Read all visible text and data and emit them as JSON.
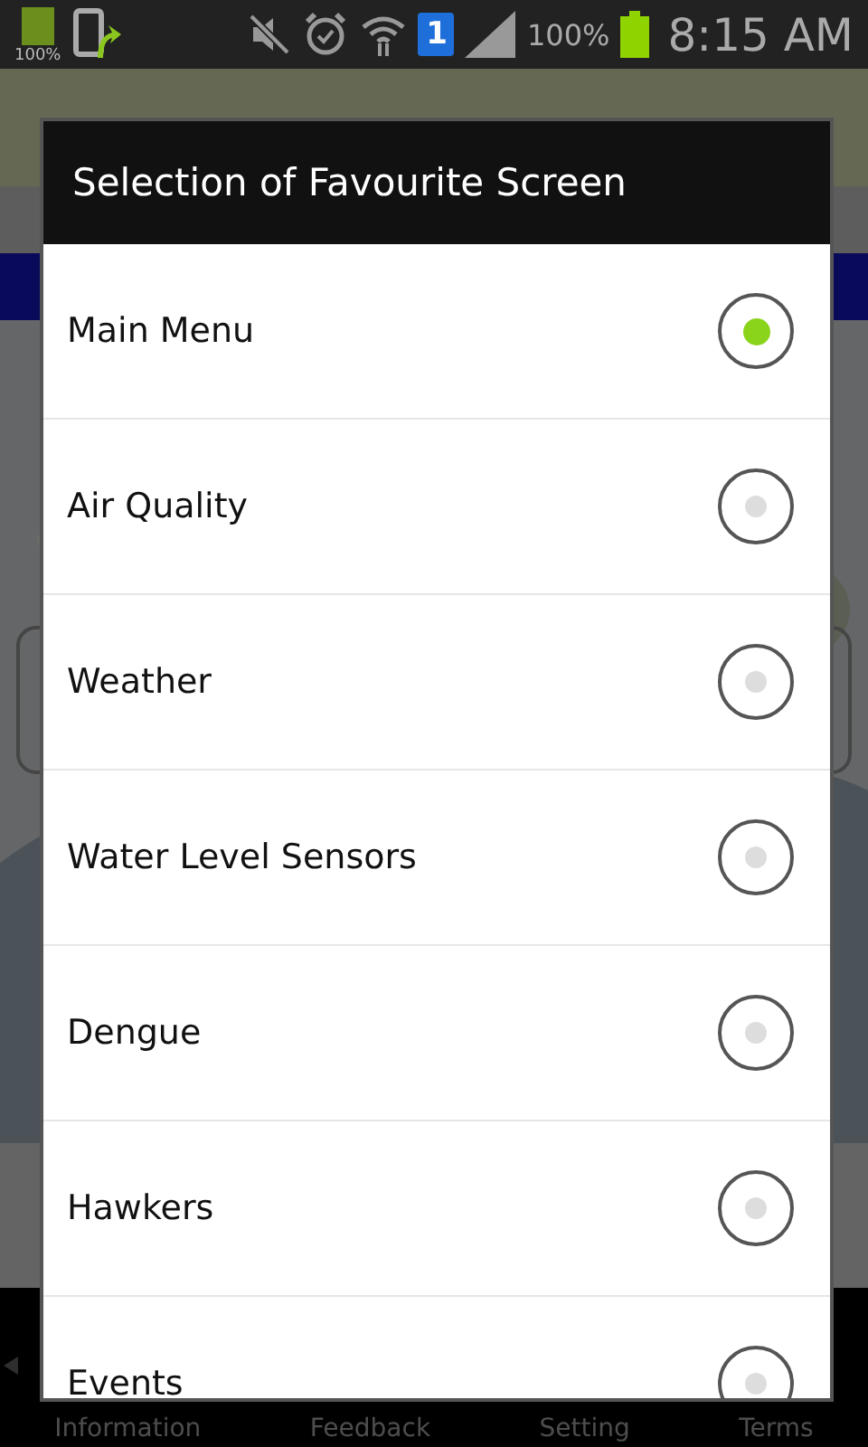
{
  "status_bar": {
    "battery_badge": "100%",
    "battery_percent": "100%",
    "sim_badge": "1",
    "time": "8:15 AM"
  },
  "dialog": {
    "title": "Selection of Favourite Screen",
    "options": [
      {
        "label": "Main Menu",
        "selected": true
      },
      {
        "label": "Air Quality",
        "selected": false
      },
      {
        "label": "Weather",
        "selected": false
      },
      {
        "label": "Water Level Sensors",
        "selected": false
      },
      {
        "label": "Dengue",
        "selected": false
      },
      {
        "label": "Hawkers",
        "selected": false
      },
      {
        "label": "Events",
        "selected": false
      }
    ]
  },
  "bottom_tabs": [
    "Information",
    "Feedback",
    "Setting",
    "Terms"
  ]
}
